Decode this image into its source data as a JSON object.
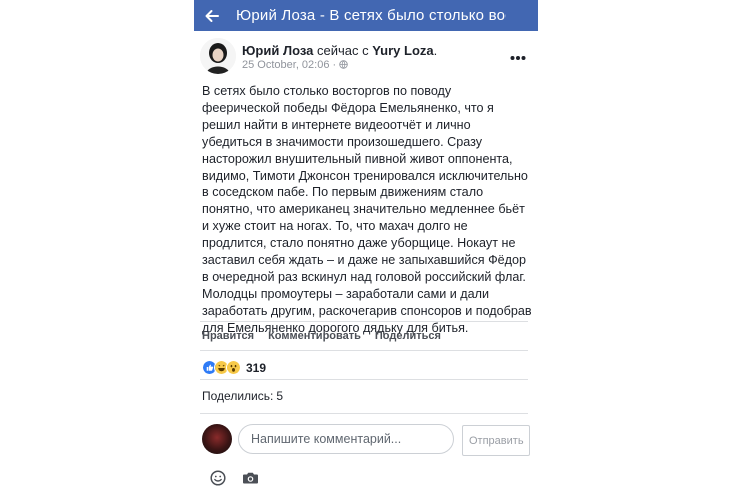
{
  "nav": {
    "title": "Юрий Лоза - В сетях было столько вост..."
  },
  "post": {
    "author": "Юрий Лоза",
    "via_text": "сейчас с",
    "with_name": "Yury Loza",
    "timestamp": "25 October, 02:06 ·",
    "privacy_icon": "globe-icon",
    "text": "В сетях было столько восторгов по поводу феерической победы Фёдора Емельяненко, что я решил найти в интернете видеоотчёт и лично убедиться в значимости произошедшего. Сразу насторожил внушительный пивной живот оппонента, видимо, Тимоти Джонсон тренировался исключительно в соседском пабе. По первым движениям стало понятно, что американец значительно медленнее бьёт и хуже стоит на ногах. То, что махач долго не продлится, стало понятно даже уборщице. Нокаут не заставил себя ждать – и даже не запыхавшийся Фёдор в очередной раз вскинул над головой российский флаг. Молодцы промоутеры – заработали сами и дали заработать другим, раскочегарив спонсоров и подобрав для Емельяненко дорогого дядьку для битья."
  },
  "actions": {
    "like": "Нравится",
    "comment": "Комментировать",
    "share": "Поделиться"
  },
  "reactions": {
    "types": [
      "like",
      "haha",
      "wow"
    ],
    "count": "319"
  },
  "shares": {
    "label": "Поделились:",
    "count": "5"
  },
  "comment_box": {
    "placeholder": "Напишите комментарий...",
    "send_label": "Отправить"
  },
  "colors": {
    "brand": "#4267b2",
    "like": "#2e7bf6",
    "reaction_yellow": "#f7c948"
  }
}
